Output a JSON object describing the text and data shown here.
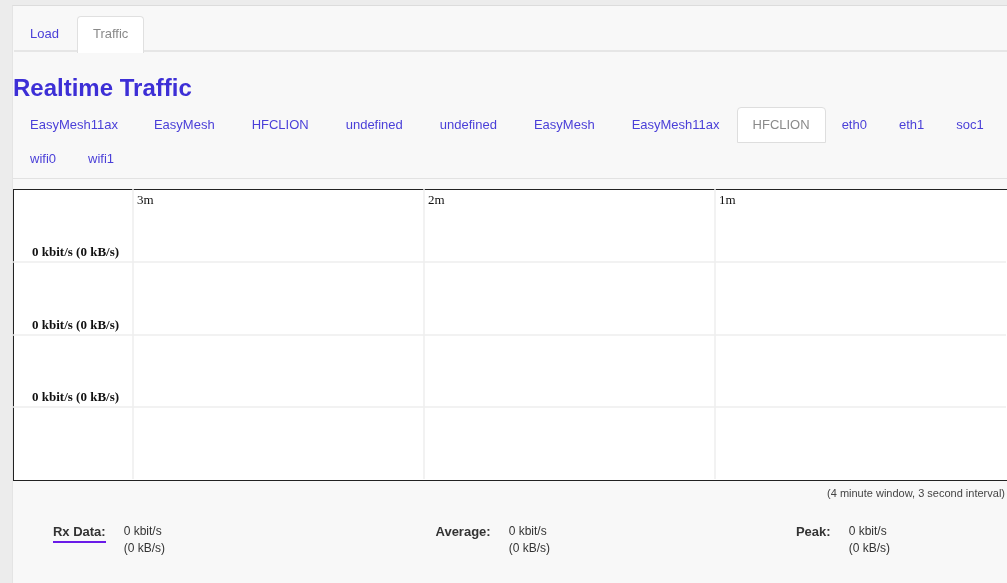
{
  "tabs": [
    {
      "label": "Load",
      "selected": false
    },
    {
      "label": "Traffic",
      "selected": true
    }
  ],
  "title": "Realtime Traffic",
  "interfaces": [
    {
      "label": "EasyMesh11ax",
      "selected": false
    },
    {
      "label": "EasyMesh",
      "selected": false
    },
    {
      "label": "HFCLION",
      "selected": false
    },
    {
      "label": "undefined",
      "selected": false
    },
    {
      "label": "undefined",
      "selected": false
    },
    {
      "label": "EasyMesh",
      "selected": false
    },
    {
      "label": "EasyMesh11ax",
      "selected": false
    },
    {
      "label": "HFCLION",
      "selected": true
    },
    {
      "label": "eth0",
      "selected": false
    },
    {
      "label": "eth1",
      "selected": false
    },
    {
      "label": "soc1",
      "selected": false
    },
    {
      "label": "wifi0",
      "selected": false
    },
    {
      "label": "wifi1",
      "selected": false
    }
  ],
  "graph": {
    "time_labels": [
      "3m",
      "2m",
      "1m"
    ],
    "rate_labels": [
      "0 kbit/s (0 kB/s)",
      "0 kbit/s (0 kB/s)",
      "0 kbit/s (0 kB/s)"
    ]
  },
  "window_note": "(4 minute window, 3 second interval)",
  "stats": [
    {
      "label": "Rx Data:",
      "kind": "legend",
      "color": "#6a1be8",
      "value": "0 kbit/s",
      "value_bytes": "(0 kB/s)"
    },
    {
      "label": "Average:",
      "kind": "plain",
      "value": "0 kbit/s",
      "value_bytes": "(0 kB/s)"
    },
    {
      "label": "Peak:",
      "kind": "plain",
      "value": "0 kbit/s",
      "value_bytes": "(0 kB/s)"
    }
  ]
}
